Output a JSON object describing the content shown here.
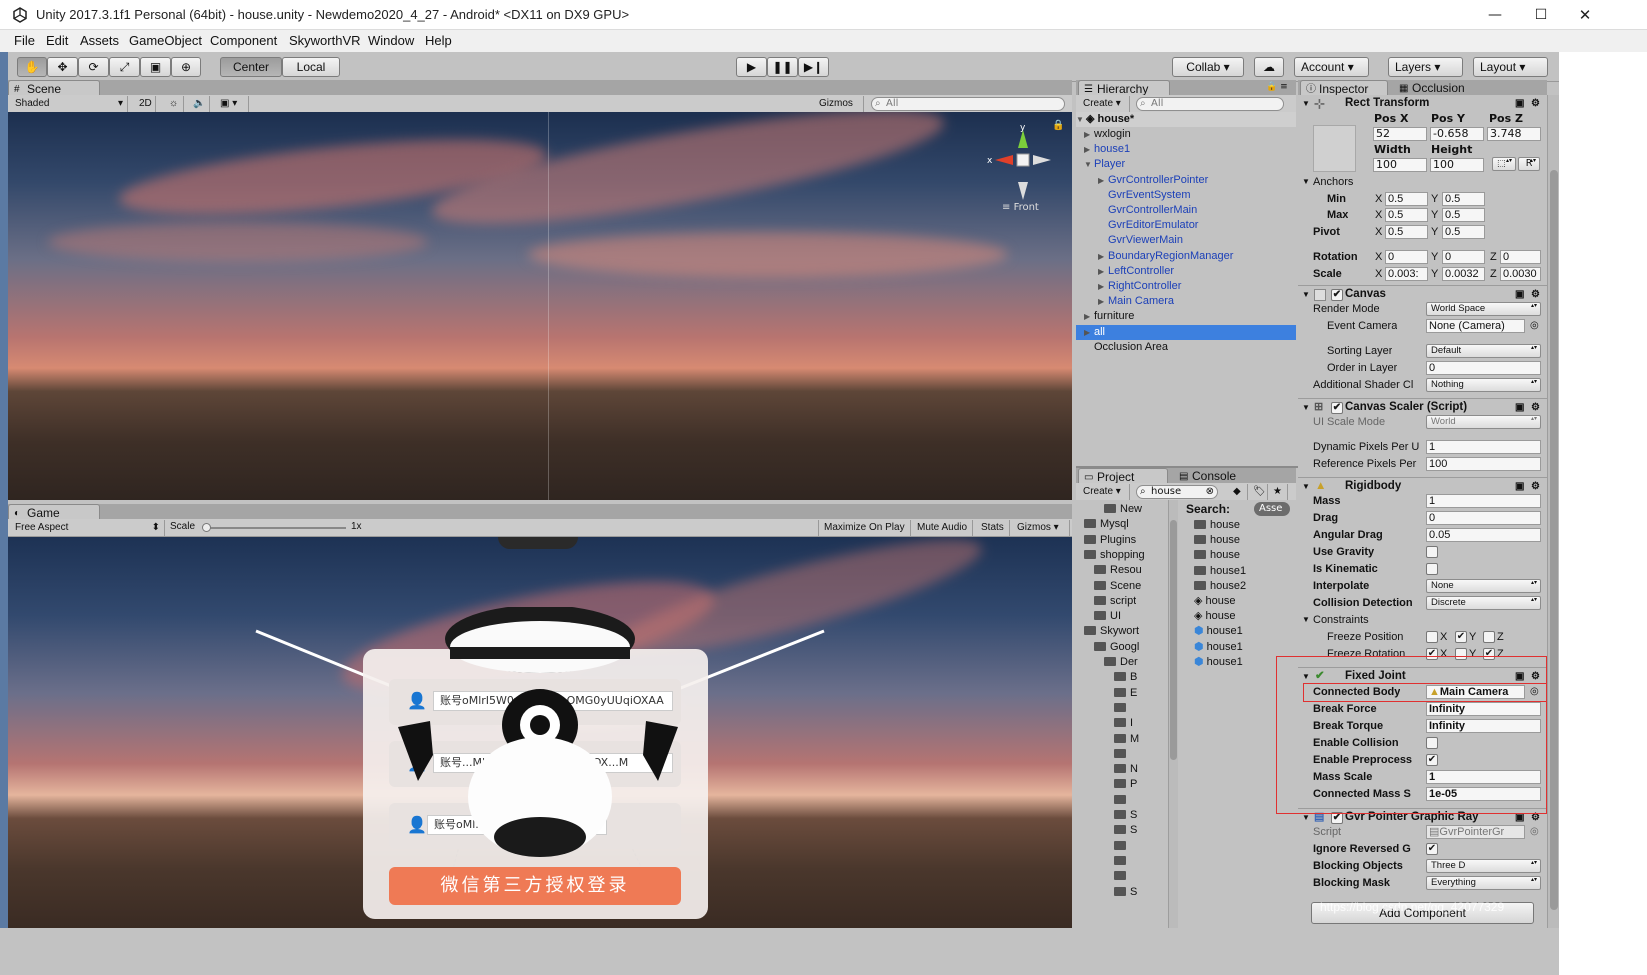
{
  "window": {
    "title": "Unity 2017.3.1f1 Personal (64bit) - house.unity - Newdemo2020_4_27 - Android* <DX11 on DX9 GPU>",
    "minimize": "—",
    "maximize": "☐",
    "close": "✕"
  },
  "menu": [
    "File",
    "Edit",
    "Assets",
    "GameObject",
    "Component",
    "SkyworthVR",
    "Window",
    "Help"
  ],
  "toolbar": {
    "center_label": "Center",
    "local_label": "Local",
    "collab_label": "Collab ▾",
    "account_label": "Account",
    "layers_label": "Layers",
    "layout_label": "Layout"
  },
  "scene": {
    "tab_label": "Scene",
    "shading": "Shaded",
    "mode_2d": "2D",
    "gizmos": "Gizmos",
    "search_placeholder": "All",
    "gizmo_axis_y": "y",
    "gizmo_axis_x": "x",
    "gizmo_view": "Front"
  },
  "game": {
    "tab_label": "Game",
    "aspect": "Free Aspect",
    "scale_label": "Scale",
    "scale_value": "1x",
    "maximize_on_play": "Maximize On Play",
    "mute_audio": "Mute Audio",
    "stats": "Stats",
    "gizmos": "Gizmos",
    "login": {
      "field1": "账号oMlrI5W0v1cTWGhOMG0yUUqiOXAA",
      "field2": "账号...Mlrl5W0...QMGUy..UqiOX...M",
      "field3": "账号oMl...                    ...Y",
      "button": "微信第三方授权登录"
    }
  },
  "hierarchy": {
    "tab_label": "Hierarchy",
    "create_label": "Create",
    "search_placeholder": "All",
    "scene_name": "house*",
    "items": [
      {
        "label": "wxlogin",
        "indent": 1,
        "blue": false,
        "arrow": true
      },
      {
        "label": "house1",
        "indent": 1,
        "blue": true,
        "arrow": true
      },
      {
        "label": "Player",
        "indent": 1,
        "blue": true,
        "arrow": true,
        "expanded": true
      },
      {
        "label": "GvrControllerPointer",
        "indent": 2,
        "blue": true,
        "arrow": true
      },
      {
        "label": "GvrEventSystem",
        "indent": 2,
        "blue": true,
        "arrow": false
      },
      {
        "label": "GvrControllerMain",
        "indent": 2,
        "blue": true,
        "arrow": false
      },
      {
        "label": "GvrEditorEmulator",
        "indent": 2,
        "blue": true,
        "arrow": false
      },
      {
        "label": "GvrViewerMain",
        "indent": 2,
        "blue": true,
        "arrow": false
      },
      {
        "label": "BoundaryRegionManager",
        "indent": 2,
        "blue": true,
        "arrow": true
      },
      {
        "label": "LeftController",
        "indent": 2,
        "blue": true,
        "arrow": true
      },
      {
        "label": "RightController",
        "indent": 2,
        "blue": true,
        "arrow": true
      },
      {
        "label": "Main Camera",
        "indent": 2,
        "blue": true,
        "arrow": true
      },
      {
        "label": "furniture",
        "indent": 1,
        "blue": false,
        "arrow": true
      },
      {
        "label": "all",
        "indent": 1,
        "blue": false,
        "arrow": true,
        "selected": true
      },
      {
        "label": "Occlusion Area",
        "indent": 1,
        "blue": false,
        "arrow": false
      }
    ]
  },
  "project": {
    "tab_label": "Project",
    "console_tab": "Console",
    "create_label": "Create",
    "search_value": "house",
    "search_label": "Search:",
    "search_scope": "Asse",
    "tree": [
      {
        "label": "New",
        "indent": 3
      },
      {
        "label": "Mysql",
        "indent": 1
      },
      {
        "label": "Plugins",
        "indent": 1
      },
      {
        "label": "shopping",
        "indent": 1
      },
      {
        "label": "Resou",
        "indent": 2
      },
      {
        "label": "Scene",
        "indent": 2
      },
      {
        "label": "script",
        "indent": 2
      },
      {
        "label": "UI",
        "indent": 2
      },
      {
        "label": "Skywort",
        "indent": 1
      },
      {
        "label": "Googl",
        "indent": 2
      },
      {
        "label": "Der",
        "indent": 3
      },
      {
        "label": "B",
        "indent": 4
      },
      {
        "label": "E",
        "indent": 4
      },
      {
        "label": "",
        "indent": 4
      },
      {
        "label": "I",
        "indent": 4
      },
      {
        "label": "M",
        "indent": 4
      },
      {
        "label": "",
        "indent": 4
      },
      {
        "label": "N",
        "indent": 4
      },
      {
        "label": "P",
        "indent": 4
      },
      {
        "label": "",
        "indent": 4
      },
      {
        "label": "S",
        "indent": 4
      },
      {
        "label": "S",
        "indent": 4
      },
      {
        "label": "",
        "indent": 4
      },
      {
        "label": "",
        "indent": 4
      },
      {
        "label": "",
        "indent": 4
      },
      {
        "label": "S",
        "indent": 4
      }
    ],
    "results": [
      {
        "label": "house",
        "icon": "folder"
      },
      {
        "label": "house",
        "icon": "folder"
      },
      {
        "label": "house",
        "icon": "folder"
      },
      {
        "label": "house1",
        "icon": "folder"
      },
      {
        "label": "house2",
        "icon": "folder"
      },
      {
        "label": "house",
        "icon": "unity"
      },
      {
        "label": "house",
        "icon": "unity"
      },
      {
        "label": "house1",
        "icon": "prefab"
      },
      {
        "label": "house1",
        "icon": "prefab"
      },
      {
        "label": "house1",
        "icon": "prefab"
      }
    ]
  },
  "inspector": {
    "tab_label": "Inspector",
    "occlusion_tab": "Occlusion",
    "rect_transform": {
      "title": "Rect Transform",
      "pos_x_label": "Pos X",
      "pos_y_label": "Pos Y",
      "pos_z_label": "Pos Z",
      "pos_x": "52",
      "pos_y": "-0.658",
      "pos_z": "3.748",
      "width_label": "Width",
      "height_label": "Height",
      "width": "100",
      "height": "100",
      "r_button": "R",
      "anchors_label": "Anchors",
      "min_label": "Min",
      "max_label": "Max",
      "pivot_label": "Pivot",
      "min_x": "0.5",
      "min_y": "0.5",
      "max_x": "0.5",
      "max_y": "0.5",
      "pivot_x": "0.5",
      "pivot_y": "0.5",
      "rotation_label": "Rotation",
      "rot_x": "0",
      "rot_y": "0",
      "rot_z": "0",
      "scale_label": "Scale",
      "scale_x": "0.003:",
      "scale_y": "0.0032",
      "scale_z": "0.0030",
      "x": "X",
      "y": "Y",
      "z": "Z"
    },
    "canvas": {
      "title": "Canvas",
      "render_mode_label": "Render Mode",
      "render_mode": "World Space",
      "event_camera_label": "Event Camera",
      "event_camera": "None (Camera)",
      "sorting_layer_label": "Sorting Layer",
      "sorting_layer": "Default",
      "order_label": "Order in Layer",
      "order": "0",
      "shader_label": "Additional Shader Cl",
      "shader": "Nothing"
    },
    "canvas_scaler": {
      "title": "Canvas Scaler (Script)",
      "ui_scale_label": "UI Scale Mode",
      "ui_scale": "World",
      "dynamic_label": "Dynamic Pixels Per U",
      "dynamic": "1",
      "reference_label": "Reference Pixels Per",
      "reference": "100"
    },
    "rigidbody": {
      "title": "Rigidbody",
      "mass_label": "Mass",
      "mass": "1",
      "drag_label": "Drag",
      "drag": "0",
      "angular_label": "Angular Drag",
      "angular": "0.05",
      "gravity_label": "Use Gravity",
      "kinematic_label": "Is Kinematic",
      "interpolate_label": "Interpolate",
      "interpolate": "None",
      "collision_label": "Collision Detection",
      "collision": "Discrete",
      "constraints_label": "Constraints",
      "freeze_pos_label": "Freeze Position",
      "freeze_rot_label": "Freeze Rotation"
    },
    "fixed_joint": {
      "title": "Fixed Joint",
      "connected_label": "Connected Body",
      "connected": "Main Camera",
      "break_force_label": "Break Force",
      "break_force": "Infinity",
      "break_torque_label": "Break Torque",
      "break_torque": "Infinity",
      "enable_collision_label": "Enable Collision",
      "enable_pre_label": "Enable Preprocess",
      "mass_scale_label": "Mass Scale",
      "mass_scale": "1",
      "connected_mass_label": "Connected Mass S",
      "connected_mass": "1e-05"
    },
    "gvr_ray": {
      "title": "Gvr Pointer Graphic Ray",
      "script_label": "Script",
      "script": "GvrPointerGr",
      "ignore_label": "Ignore Reversed G",
      "blocking_objects_label": "Blocking Objects",
      "blocking_objects": "Three D",
      "blocking_mask_label": "Blocking Mask",
      "blocking_mask": "Everything"
    },
    "add_component": "Add Component",
    "watermark": "https://blog.csdn.net/qq_42077329",
    "highlight_color": "#e03030"
  }
}
